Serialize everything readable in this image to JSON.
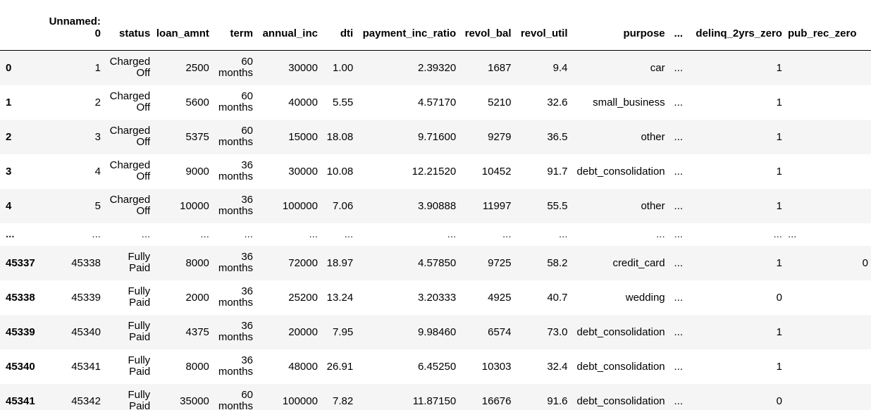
{
  "columns": [
    "",
    "Unnamed: 0",
    "status",
    "loan_amnt",
    "term",
    "annual_inc",
    "dti",
    "payment_inc_ratio",
    "revol_bal",
    "revol_util",
    "purpose",
    "...",
    "delinq_2yrs_zero",
    "pub_rec_zero"
  ],
  "rows": [
    {
      "index": "0",
      "unnamed": "1",
      "status": "Charged Off",
      "loan_amnt": "2500",
      "term": "60 months",
      "annual_inc": "30000",
      "dti": "1.00",
      "payment_inc_ratio": "2.39320",
      "revol_bal": "1687",
      "revol_util": "9.4",
      "purpose": "car",
      "dots": "...",
      "delinq_2yrs_zero": "1",
      "pub_rec_zero": ""
    },
    {
      "index": "1",
      "unnamed": "2",
      "status": "Charged Off",
      "loan_amnt": "5600",
      "term": "60 months",
      "annual_inc": "40000",
      "dti": "5.55",
      "payment_inc_ratio": "4.57170",
      "revol_bal": "5210",
      "revol_util": "32.6",
      "purpose": "small_business",
      "dots": "...",
      "delinq_2yrs_zero": "1",
      "pub_rec_zero": ""
    },
    {
      "index": "2",
      "unnamed": "3",
      "status": "Charged Off",
      "loan_amnt": "5375",
      "term": "60 months",
      "annual_inc": "15000",
      "dti": "18.08",
      "payment_inc_ratio": "9.71600",
      "revol_bal": "9279",
      "revol_util": "36.5",
      "purpose": "other",
      "dots": "...",
      "delinq_2yrs_zero": "1",
      "pub_rec_zero": ""
    },
    {
      "index": "3",
      "unnamed": "4",
      "status": "Charged Off",
      "loan_amnt": "9000",
      "term": "36 months",
      "annual_inc": "30000",
      "dti": "10.08",
      "payment_inc_ratio": "12.21520",
      "revol_bal": "10452",
      "revol_util": "91.7",
      "purpose": "debt_consolidation",
      "dots": "...",
      "delinq_2yrs_zero": "1",
      "pub_rec_zero": ""
    },
    {
      "index": "4",
      "unnamed": "5",
      "status": "Charged Off",
      "loan_amnt": "10000",
      "term": "36 months",
      "annual_inc": "100000",
      "dti": "7.06",
      "payment_inc_ratio": "3.90888",
      "revol_bal": "11997",
      "revol_util": "55.5",
      "purpose": "other",
      "dots": "...",
      "delinq_2yrs_zero": "1",
      "pub_rec_zero": ""
    },
    {
      "index": "...",
      "unnamed": "...",
      "status": "...",
      "loan_amnt": "...",
      "term": "...",
      "annual_inc": "...",
      "dti": "...",
      "payment_inc_ratio": "...",
      "revol_bal": "...",
      "revol_util": "...",
      "purpose": "...",
      "dots": "...",
      "delinq_2yrs_zero": "...",
      "pub_rec_zero": "..."
    },
    {
      "index": "45337",
      "unnamed": "45338",
      "status": "Fully Paid",
      "loan_amnt": "8000",
      "term": "36 months",
      "annual_inc": "72000",
      "dti": "18.97",
      "payment_inc_ratio": "4.57850",
      "revol_bal": "9725",
      "revol_util": "58.2",
      "purpose": "credit_card",
      "dots": "...",
      "delinq_2yrs_zero": "1",
      "pub_rec_zero": "0"
    },
    {
      "index": "45338",
      "unnamed": "45339",
      "status": "Fully Paid",
      "loan_amnt": "2000",
      "term": "36 months",
      "annual_inc": "25200",
      "dti": "13.24",
      "payment_inc_ratio": "3.20333",
      "revol_bal": "4925",
      "revol_util": "40.7",
      "purpose": "wedding",
      "dots": "...",
      "delinq_2yrs_zero": "0",
      "pub_rec_zero": ""
    },
    {
      "index": "45339",
      "unnamed": "45340",
      "status": "Fully Paid",
      "loan_amnt": "4375",
      "term": "36 months",
      "annual_inc": "20000",
      "dti": "7.95",
      "payment_inc_ratio": "9.98460",
      "revol_bal": "6574",
      "revol_util": "73.0",
      "purpose": "debt_consolidation",
      "dots": "...",
      "delinq_2yrs_zero": "1",
      "pub_rec_zero": ""
    },
    {
      "index": "45340",
      "unnamed": "45341",
      "status": "Fully Paid",
      "loan_amnt": "8000",
      "term": "36 months",
      "annual_inc": "48000",
      "dti": "26.91",
      "payment_inc_ratio": "6.45250",
      "revol_bal": "10303",
      "revol_util": "32.4",
      "purpose": "debt_consolidation",
      "dots": "...",
      "delinq_2yrs_zero": "1",
      "pub_rec_zero": ""
    },
    {
      "index": "45341",
      "unnamed": "45342",
      "status": "Fully Paid",
      "loan_amnt": "35000",
      "term": "60 months",
      "annual_inc": "100000",
      "dti": "7.82",
      "payment_inc_ratio": "11.87150",
      "revol_bal": "16676",
      "revol_util": "91.6",
      "purpose": "debt_consolidation",
      "dots": "...",
      "delinq_2yrs_zero": "0",
      "pub_rec_zero": ""
    }
  ]
}
